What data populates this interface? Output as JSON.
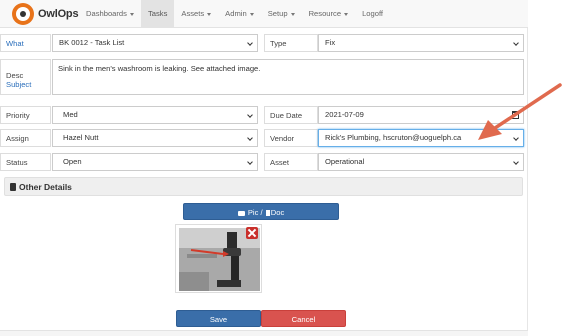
{
  "brand": {
    "name": "OwlOps"
  },
  "nav": [
    {
      "label": "Dashboards",
      "dropdown": true,
      "active": false
    },
    {
      "label": "Tasks",
      "dropdown": false,
      "active": true
    },
    {
      "label": "Assets",
      "dropdown": true,
      "active": false
    },
    {
      "label": "Admin",
      "dropdown": true,
      "active": false
    },
    {
      "label": "Setup",
      "dropdown": true,
      "active": false
    },
    {
      "label": "Resource",
      "dropdown": true,
      "active": false
    },
    {
      "label": "Logoff",
      "dropdown": false,
      "active": false
    }
  ],
  "form": {
    "what": {
      "label": "What",
      "value": "BK 0012 - Task List"
    },
    "type": {
      "label": "Type",
      "value": "Fix"
    },
    "desc": {
      "label": "Desc",
      "sublabel": "Subject",
      "value": "Sink in the men's washroom is leaking. See attached image."
    },
    "priority": {
      "label": "Priority",
      "value": "Med"
    },
    "due_date": {
      "label": "Due Date",
      "value": "2021-07-09"
    },
    "assign": {
      "label": "Assign",
      "value": "Hazel Nutt"
    },
    "vendor": {
      "label": "Vendor",
      "value": "Rick's Plumbing, hscruton@uoguelph.ca"
    },
    "status": {
      "label": "Status",
      "value": "Open"
    },
    "asset": {
      "label": "Asset",
      "value": "Operational"
    }
  },
  "other_details": {
    "label": "Other Details"
  },
  "buttons": {
    "pic_doc": "Pic / ",
    "pic_doc_suffix": "Doc",
    "save": "Save",
    "cancel": "Cancel"
  },
  "colors": {
    "primary": "#3a6ea9",
    "danger": "#d9534f",
    "brand_orange": "#e8731a",
    "annotation_arrow": "#e06a4e",
    "link": "#2a6ebb"
  },
  "icons": [
    "owl-logo-icon",
    "caret-down-icon",
    "calendar-icon",
    "book-icon",
    "camera-icon",
    "file-icon",
    "delete-x-icon",
    "annotation-arrow"
  ]
}
